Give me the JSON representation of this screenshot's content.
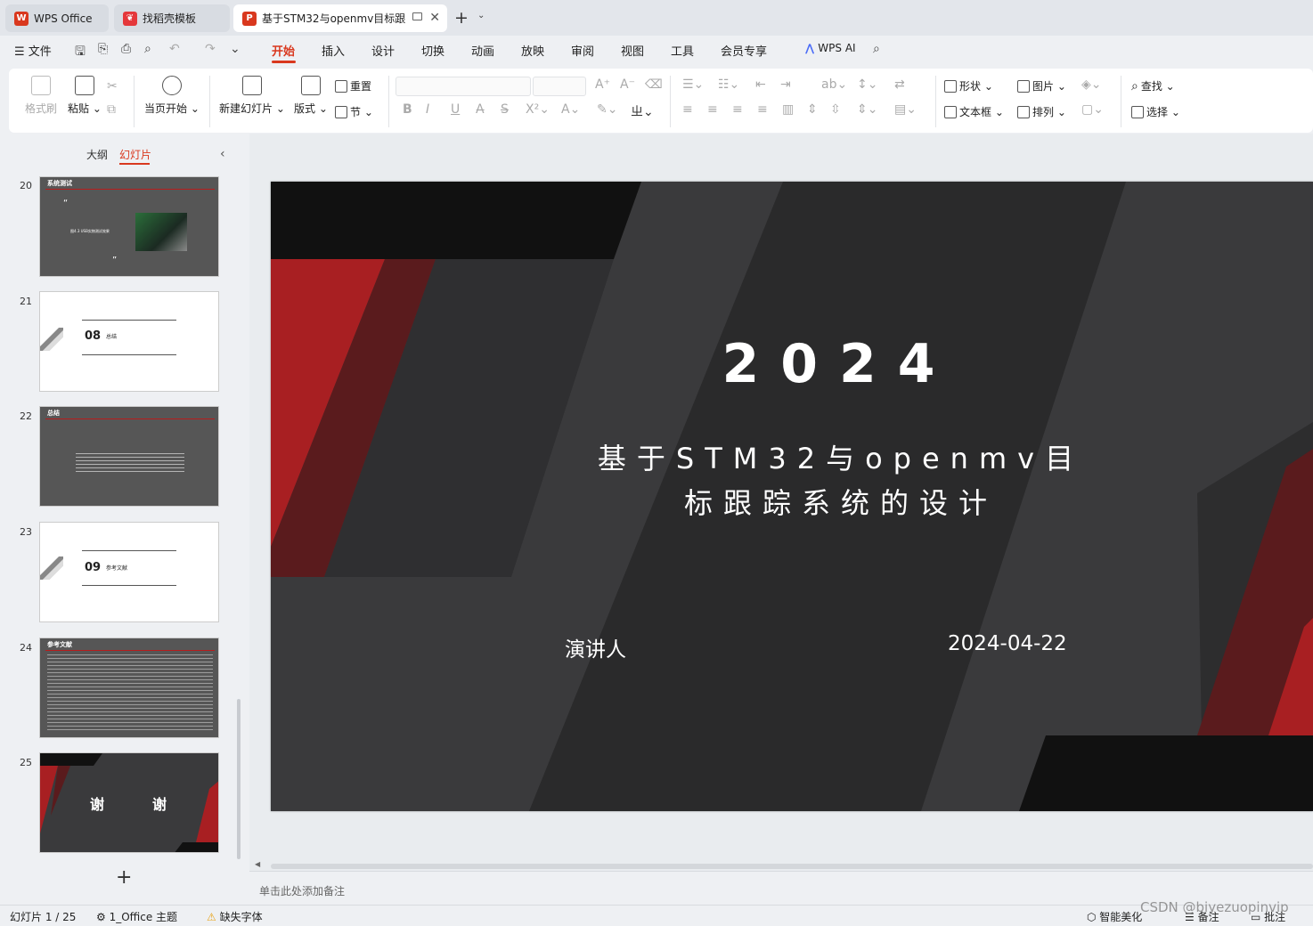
{
  "tabs": [
    {
      "label": "WPS Office",
      "icon": "wps-logo-icon",
      "icon_color": "#d9381e"
    },
    {
      "label": "找稻壳模板",
      "icon": "docer-icon",
      "icon_color": "#e5383b"
    },
    {
      "label": "基于STM32与openmv目标跟",
      "icon": "presentation-icon",
      "icon_color": "#d9381e"
    }
  ],
  "menu": {
    "file": "文件",
    "items": [
      "开始",
      "插入",
      "设计",
      "切换",
      "动画",
      "放映",
      "审阅",
      "视图",
      "工具",
      "会员专享"
    ],
    "active": "开始",
    "wps_ai": "WPS AI"
  },
  "ribbon": {
    "format_painter": "格式刷",
    "paste": "粘贴",
    "play_from_current": "当页开始",
    "new_slide": "新建幻灯片",
    "layout": "版式",
    "reset": "重置",
    "section": "节",
    "shape": "形状",
    "picture": "图片",
    "textbox": "文本框",
    "arrange": "排列",
    "find": "查找",
    "select": "选择"
  },
  "panel": {
    "outline_tab": "大纲",
    "slides_tab": "幻灯片",
    "thumbnails": [
      {
        "num": "20",
        "title": "系统测试",
        "caption": "图4.3 USB实物测试效果"
      },
      {
        "num": "21",
        "section_num": "08",
        "section_title": "总结"
      },
      {
        "num": "22",
        "title": "总结"
      },
      {
        "num": "23",
        "section_num": "09",
        "section_title": "参考文献"
      },
      {
        "num": "24",
        "title": "参考文献"
      },
      {
        "num": "25",
        "thanks_left": "谢",
        "thanks_right": "谢"
      }
    ]
  },
  "slide": {
    "year": "2024",
    "title_line1": "基于STM32与openmv目",
    "title_line2": "标跟踪系统的设计",
    "presenter": "演讲人",
    "date": "2024-04-22",
    "colors": {
      "dark": "#3a3a3c",
      "black": "#111111",
      "red": "#a81f22",
      "darkred": "#5a1b1d"
    }
  },
  "notes_placeholder": "单击此处添加备注",
  "status": {
    "slide_count": "幻灯片 1 / 25",
    "theme": "1_Office 主题",
    "missing_font": "缺失字体",
    "beautify": "智能美化",
    "notes": "备注",
    "comments": "批注"
  },
  "watermark": "CSDN @biyezuopinvip"
}
